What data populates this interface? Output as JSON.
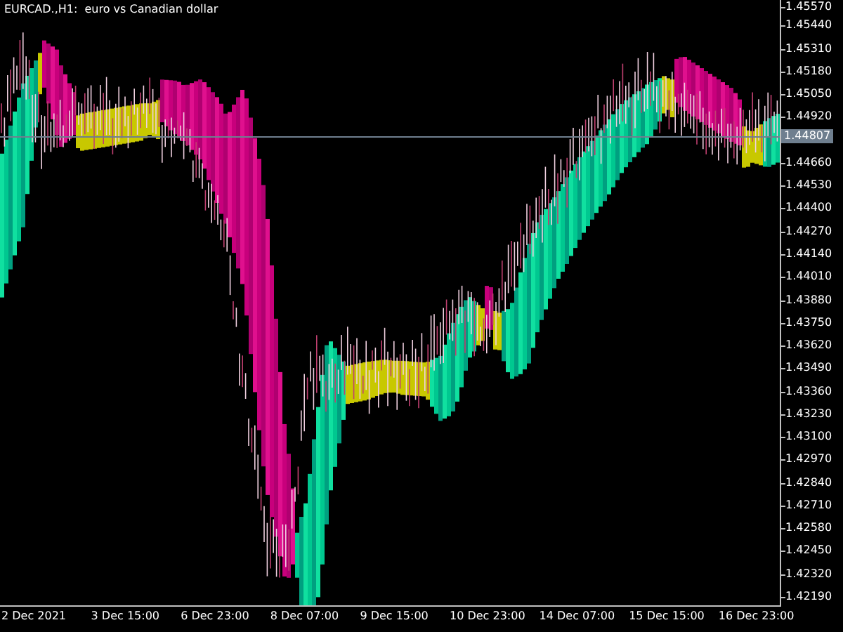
{
  "chart": {
    "title": "EURCAD.,H1:  euro vs Canadian dollar",
    "price_labels": [
      "1.45570",
      "1.45440",
      "1.45310",
      "1.45180",
      "1.45050",
      "1.44920",
      "1.44660",
      "1.44530",
      "1.44400",
      "1.44270",
      "1.44140",
      "1.44010",
      "1.43880",
      "1.43750",
      "1.43620",
      "1.43490",
      "1.43360",
      "1.43230",
      "1.43100",
      "1.42970",
      "1.42840",
      "1.42710",
      "1.42580",
      "1.42450",
      "1.42320",
      "1.42190"
    ],
    "current_price": "1.44807",
    "time_labels": [
      "2 Dec 2021",
      "3 Dec 15:00",
      "6 Dec 23:00",
      "8 Dec 07:00",
      "9 Dec 15:00",
      "10 Dec 23:00",
      "14 Dec 07:00",
      "15 Dec 15:00",
      "16 Dec 23:00"
    ]
  }
}
